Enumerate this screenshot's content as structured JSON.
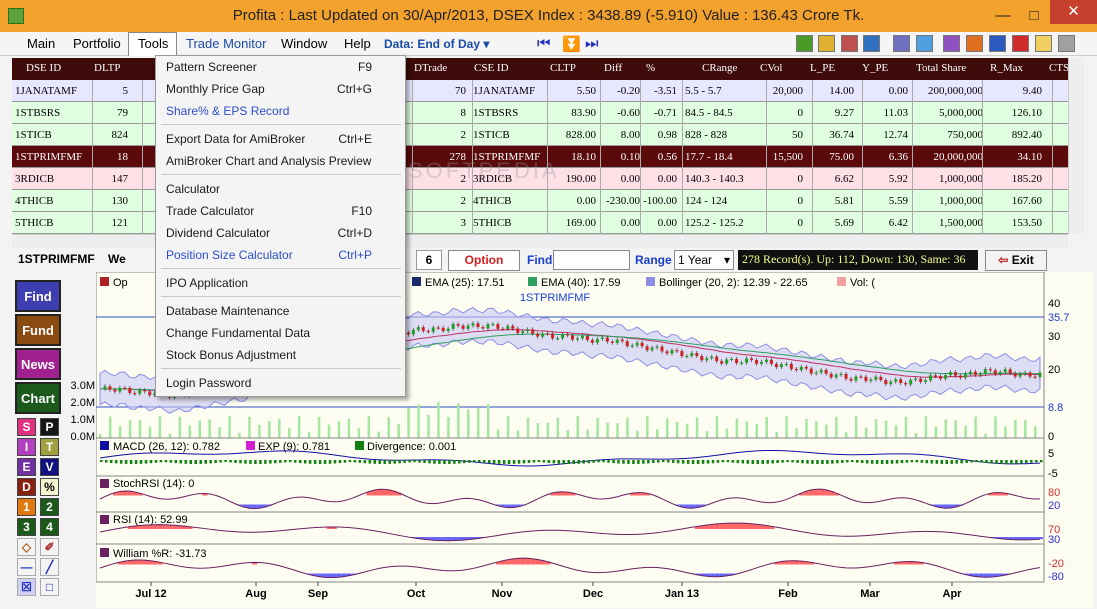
{
  "window": {
    "title": "Profita : Last Updated on 30/Apr/2013,  DSEX Index : 3438.89 (-5.910)  Value : 136.43 Crore Tk.",
    "minimize": "—",
    "maximize": "□",
    "close": "✕"
  },
  "menubar": {
    "items": [
      "Main",
      "Portfolio",
      "Tools",
      "Trade Monitor",
      "Window",
      "Help"
    ],
    "data_selector": "Data: End of Day ▾"
  },
  "toolbar": {
    "nav": [
      "⏮",
      "⏬",
      "⏭"
    ]
  },
  "tools_menu": {
    "items": [
      {
        "label": "Pattern Screener",
        "shortcut": "F9"
      },
      {
        "label": "Monthly Price Gap",
        "shortcut": "Ctrl+G"
      },
      {
        "label": "Share% & EPS Record",
        "shortcut": ""
      },
      {
        "label": "Export Data for AmiBroker",
        "shortcut": "Ctrl+E"
      },
      {
        "label": "AmiBroker Chart and Analysis Preview",
        "shortcut": ""
      },
      {
        "label": "Calculator",
        "shortcut": ""
      },
      {
        "label": "Trade Calculator",
        "shortcut": "F10"
      },
      {
        "label": "Dividend Calculator",
        "shortcut": "Ctrl+D"
      },
      {
        "label": "Position Size Calculator",
        "shortcut": "Ctrl+P"
      },
      {
        "label": "IPO Application",
        "shortcut": ""
      },
      {
        "label": "Database Maintenance",
        "shortcut": ""
      },
      {
        "label": "Change Fundamental Data",
        "shortcut": ""
      },
      {
        "label": "Stock Bonus Adjustment",
        "shortcut": ""
      },
      {
        "label": "Login Password",
        "shortcut": ""
      }
    ]
  },
  "table": {
    "headers": [
      "DSE ID",
      "DLTP",
      "DTrade",
      "CSE ID",
      "CLTP",
      "Diff",
      "%",
      "CRange",
      "CVol",
      "L_PE",
      "Y_PE",
      "Total Share",
      "R_Max",
      "CTS"
    ],
    "rows": [
      {
        "dse_id": "1JANATAMF",
        "dltp": "5",
        "dtrade": "70",
        "cse_id": "1JANATAMF",
        "cltp": "5.50",
        "diff": "-0.20",
        "pct": "-3.51",
        "crange": "5.5 -  5.7",
        "cvol": "20,000",
        "lpe": "14.00",
        "ype": "0.00",
        "total": "200,000,000",
        "rmax": "9.40"
      },
      {
        "dse_id": "1STBSRS",
        "dltp": "79",
        "dtrade": "8",
        "cse_id": "1STBSRS",
        "cltp": "83.90",
        "diff": "-0.60",
        "pct": "-0.71",
        "crange": "84.5 -  84.5",
        "cvol": "0",
        "lpe": "9.27",
        "ype": "11.03",
        "total": "5,000,000",
        "rmax": "126.10"
      },
      {
        "dse_id": "1STICB",
        "dltp": "824",
        "dtrade": "2",
        "cse_id": "1STICB",
        "cltp": "828.00",
        "diff": "8.00",
        "pct": "0.98",
        "crange": "828 -  828",
        "cvol": "50",
        "lpe": "36.74",
        "ype": "12.74",
        "total": "750,000",
        "rmax": "892.40"
      },
      {
        "dse_id": "1STPRIMFMF",
        "dltp": "18",
        "dtrade": "278",
        "cse_id": "1STPRIMFMF",
        "cltp": "18.10",
        "diff": "0.10",
        "pct": "0.56",
        "crange": "17.7 -  18.4",
        "cvol": "15,500",
        "lpe": "75.00",
        "ype": "6.36",
        "total": "20,000,000",
        "rmax": "34.10"
      },
      {
        "dse_id": "3RDICB",
        "dltp": "147",
        "dtrade": "2",
        "cse_id": "3RDICB",
        "cltp": "190.00",
        "diff": "0.00",
        "pct": "0.00",
        "crange": "140.3 -  140.3",
        "cvol": "0",
        "lpe": "6.62",
        "ype": "5.92",
        "total": "1,000,000",
        "rmax": "185.20"
      },
      {
        "dse_id": "4THICB",
        "dltp": "130",
        "dtrade": "2",
        "cse_id": "4THICB",
        "cltp": "0.00",
        "diff": "-230.00",
        "pct": "-100.00",
        "crange": "124 -  124",
        "cvol": "0",
        "lpe": "5.81",
        "ype": "5.59",
        "total": "1,000,000",
        "rmax": "167.60"
      },
      {
        "dse_id": "5THICB",
        "dltp": "121",
        "dtrade": "3",
        "cse_id": "5THICB",
        "cltp": "169.00",
        "diff": "0.00",
        "pct": "0.00",
        "crange": "125.2 -  125.2",
        "cvol": "0",
        "lpe": "5.69",
        "ype": "6.42",
        "total": "1,500,000",
        "rmax": "153.50"
      }
    ]
  },
  "controls": {
    "stock_tab": "1STPRIMFMF",
    "second_tab": "We",
    "tab_number": "6",
    "option_button": "Option",
    "find_label": "Find",
    "find_value": "",
    "range_label": "Range",
    "range_value": "1 Year",
    "records_status": "278 Record(s). Up: 112, Down: 130, Same: 36",
    "exit_button": "Exit"
  },
  "left_panel": {
    "big_buttons": [
      "Find",
      "Fund",
      "News",
      "Chart"
    ],
    "small_buttons": [
      [
        "S",
        "P"
      ],
      [
        "I",
        "T"
      ],
      [
        "E",
        "V"
      ],
      [
        "D",
        "%"
      ],
      [
        "1",
        "2"
      ],
      [
        "3",
        "4"
      ]
    ],
    "draw_tools": [
      "◇",
      "✐",
      "—",
      "╱",
      "☒",
      "□"
    ]
  },
  "chart": {
    "title": "1STPRIMFMF",
    "legend": [
      "Op",
      "EMA (25): 17.51",
      "EMA (40): 17.59",
      "Bollinger (20, 2): 12.39 - 22.65",
      "Vol: ("
    ],
    "price_axis": [
      "40",
      "35.7",
      "30",
      "20",
      "8.8",
      "0"
    ],
    "volume_axis": [
      "3.0M",
      "2.0M",
      "1.0M",
      "0.0M"
    ],
    "months": [
      "Jul 12",
      "Aug",
      "Sep",
      "Oct",
      "Nov",
      "Dec",
      "Jan 13",
      "Feb",
      "Mar",
      "Apr"
    ],
    "macd": {
      "legend": [
        "MACD (26, 12): 0.782",
        "EXP (9): 0.781",
        "Divergence: 0.001"
      ],
      "axis": [
        "5",
        "-5"
      ]
    },
    "stochrsi": {
      "legend": "StochRSI (14): 0",
      "axis": [
        "80",
        "20"
      ]
    },
    "rsi": {
      "legend": "RSI (14): 52.99",
      "axis": [
        "70",
        "30"
      ]
    },
    "william": {
      "legend": "William %R: -31.73",
      "axis": [
        "-20",
        "-80"
      ]
    },
    "colors": {
      "up_candle": "#22a022",
      "down_candle": "#d02020",
      "ema25": "#c03060",
      "ema40": "#30a060",
      "bollinger": "#8d8de8",
      "volume": "#a6e6a0",
      "macd": "#1010a0",
      "divergence": "#108010",
      "band": "#ff6666",
      "band_low": "#6666ff"
    },
    "price_series": [
      14,
      14,
      13,
      13,
      12,
      13,
      14,
      15,
      16,
      20,
      24,
      28,
      29,
      30,
      30,
      29,
      30,
      31,
      31,
      32,
      32,
      32,
      31,
      30,
      29,
      29,
      28,
      28,
      27,
      26,
      25,
      24,
      23,
      22,
      22,
      22,
      21,
      20,
      19,
      18,
      17,
      17,
      16,
      16,
      17,
      18,
      18,
      19,
      19,
      18,
      18
    ]
  },
  "watermark": "SOFTPEDIA"
}
